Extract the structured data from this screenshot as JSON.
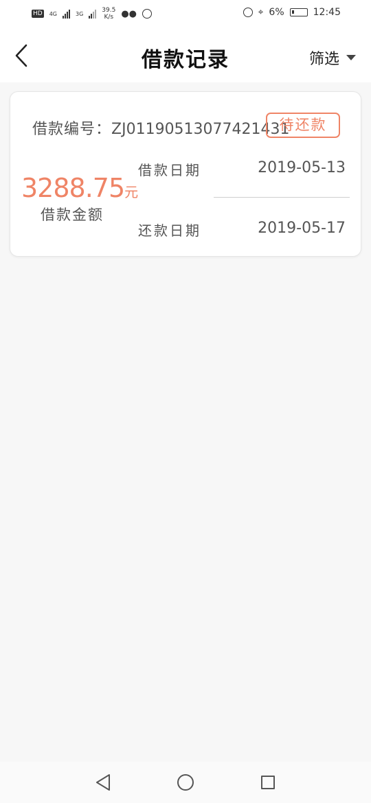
{
  "status_bar": {
    "hd": "HD",
    "net1": "4G",
    "net2": "3G",
    "speed_value": "39.5",
    "speed_unit": "K/s",
    "battery": "6%",
    "time": "12:45"
  },
  "header": {
    "title": "借款记录",
    "filter_label": "筛选"
  },
  "loan_card": {
    "number_label": "借款编号：",
    "number_value": "ZJ01190513077421431",
    "status": "待还款",
    "amount": "3288.75",
    "amount_unit": "元",
    "amount_label": "借款金额",
    "loan_date_label": "借款日期",
    "loan_date": "2019-05-13",
    "repay_date_label": "还款日期",
    "repay_date": "2019-05-17"
  },
  "colors": {
    "accent": "#ef8466",
    "text": "#555555",
    "title": "#111111"
  }
}
